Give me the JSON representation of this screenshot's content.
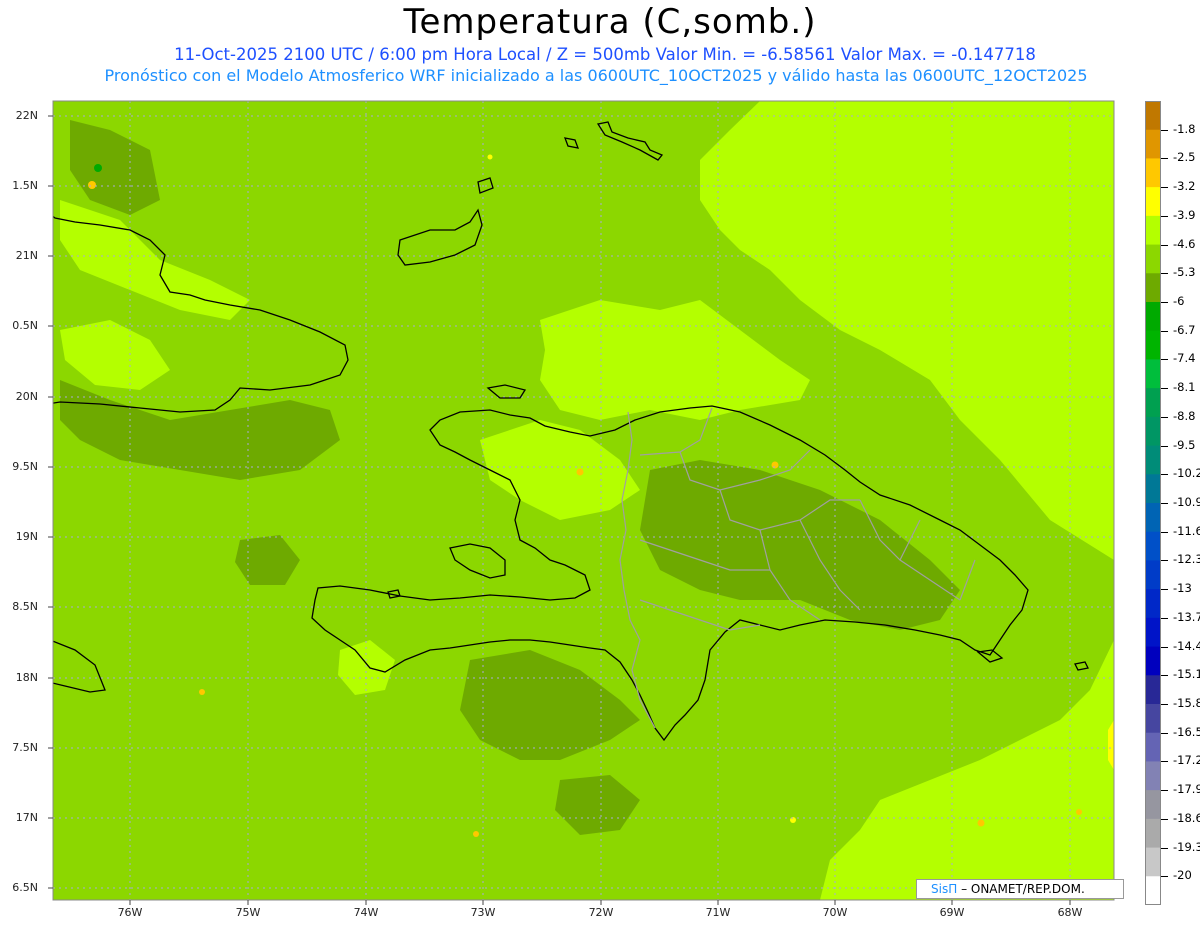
{
  "title": "Temperatura (C,somb.)",
  "subtitle_line1": "11-Oct-2025  2100 UTC / 6:00 pm Hora Local / Z = 500mb  Valor Min. = -6.58561  Valor Max. = -0.147718",
  "subtitle_line2": "Pronóstico con el Modelo Atmosferico WRF inicializado a las 0600UTC_10OCT2025 y válido hasta las  0600UTC_12OCT2025",
  "credit": {
    "brand": "SisΠ",
    "text": "– ONAMET/REP.DOM."
  },
  "lat_labels": [
    "22N",
    "1.5N",
    "21N",
    "0.5N",
    "20N",
    "9.5N",
    "19N",
    "8.5N",
    "18N",
    "7.5N",
    "17N",
    "6.5N"
  ],
  "lon_labels": [
    "76W",
    "75W",
    "74W",
    "73W",
    "72W",
    "71W",
    "70W",
    "69W",
    "68W"
  ],
  "colorbar": {
    "labels": [
      "-1.8",
      "-2.5",
      "-3.2",
      "-3.9",
      "-4.6",
      "-5.3",
      "-6",
      "-6.7",
      "-7.4",
      "-8.1",
      "-8.8",
      "-9.5",
      "-10.2",
      "-10.9",
      "-11.6",
      "-12.3",
      "-13",
      "-13.7",
      "-14.4",
      "-15.1",
      "-15.8",
      "-16.5",
      "-17.2",
      "-17.9",
      "-18.6",
      "-19.3",
      "-20"
    ],
    "colors": [
      "#c07800",
      "#e09600",
      "#ffc800",
      "#ffff00",
      "#b4ff00",
      "#8cd700",
      "#6eaa00",
      "#00aa00",
      "#00b400",
      "#00be3c",
      "#00a050",
      "#009664",
      "#008c78",
      "#007896",
      "#0064b4",
      "#0050c8",
      "#003cc8",
      "#0028c8",
      "#0014c8",
      "#0000be",
      "#282896",
      "#4646a0",
      "#6464b4",
      "#8282b4",
      "#9696a0",
      "#aaaaaa",
      "#c8c8c8",
      "#ffffff"
    ]
  },
  "legend_colors": {
    "map_base": "#8cd700",
    "map_light": "#b4ff00",
    "map_dark": "#6eaa00",
    "subtitle_blue": "#1e50ff"
  }
}
